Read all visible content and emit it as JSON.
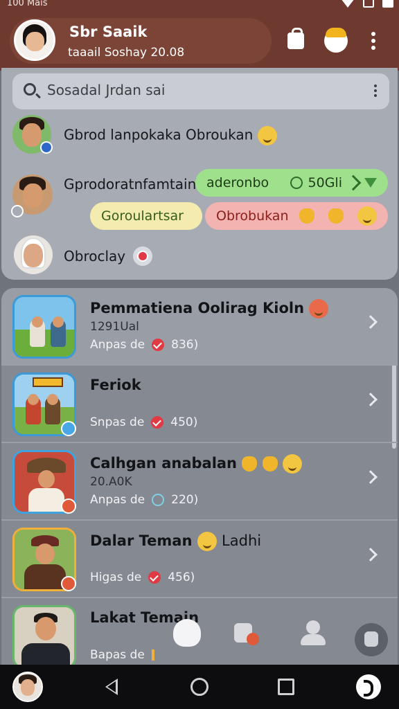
{
  "status_bar": {
    "left_text": "100 Mais"
  },
  "header": {
    "name": "Sbr Saaik",
    "subtitle": "taaail Soshay 20.08"
  },
  "search": {
    "placeholder": "Sosadal Jrdan sai"
  },
  "chats": [
    {
      "text": "Gbrod lanpokaka Obroukan"
    },
    {
      "text": "Gprodoratnfamtain"
    },
    {
      "text": "Obroclay"
    }
  ],
  "chips": {
    "green": "aderonbo",
    "green_value": "50Gli",
    "yellow": "Goroulartsar",
    "pink": "Obrobukan"
  },
  "list": [
    {
      "title": "Pemmatiena Oolirag Kioln",
      "count": "1291Ual",
      "meta_label": "Anpas de",
      "meta_value": "836)"
    },
    {
      "title": "Feriok",
      "count": "",
      "meta_label": "Snpas de",
      "meta_value": "450)"
    },
    {
      "title": "Calhgan anabalan",
      "count": "20.A0K",
      "meta_label": "Anpas de",
      "meta_value": "220)"
    },
    {
      "title": "Dalar Teman",
      "title_suffix": "Ladhi",
      "count": "",
      "meta_label": "Higas de",
      "meta_value": "456)"
    },
    {
      "title": "Lakat Temain",
      "count": "",
      "meta_label": "Bapas de",
      "meta_value": ""
    }
  ],
  "colors": {
    "header": "#6e3a2f",
    "card": "#a7abb3",
    "list": "#858991",
    "chip_green": "#9fe08c",
    "chip_yellow": "#f3ecae",
    "chip_pink": "#f2b3b1"
  },
  "icons": [
    "bag-icon",
    "face-icon",
    "more-icon",
    "search-icon",
    "chevron-right-icon",
    "heart-check-icon",
    "clock-icon",
    "back-icon",
    "home-icon",
    "recents-icon"
  ]
}
